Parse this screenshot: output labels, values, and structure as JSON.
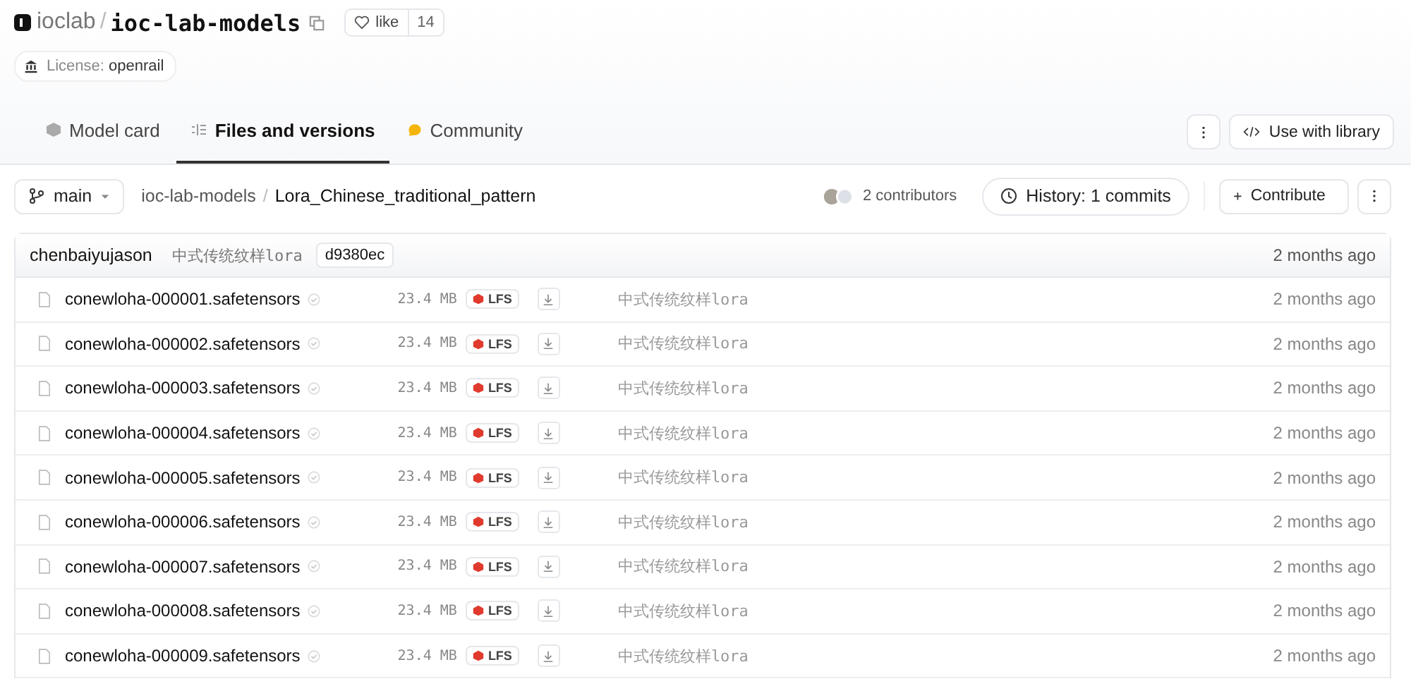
{
  "repo": {
    "owner": "ioclab",
    "separator": "/",
    "name": "ioc-lab-models",
    "like_label": "like",
    "likes": "14"
  },
  "license": {
    "label": "License:",
    "value": "openrail"
  },
  "tabs": [
    {
      "kind": "card",
      "label": "Model card",
      "selected": false
    },
    {
      "kind": "files",
      "label": "Files and versions",
      "selected": true
    },
    {
      "kind": "community",
      "label": "Community",
      "selected": false
    }
  ],
  "actions": {
    "use_with_library": "Use with library"
  },
  "toolbar": {
    "branch": "main",
    "path": [
      {
        "label": "ioc-lab-models"
      },
      {
        "label": "Lora_Chinese_traditional_pattern"
      }
    ],
    "path_separator": "/",
    "contributors": "2 contributors",
    "history": "History: 1 commits",
    "contribute": "Contribute"
  },
  "last_commit": {
    "author": "chenbaiyujason",
    "message": "中式传统纹样lora",
    "hash": "d9380ec",
    "date": "2 months ago"
  },
  "files": [
    {
      "name": "conewloha-000001.safetensors",
      "size": "23.4 MB",
      "lfs": "LFS",
      "message": "中式传统纹样lora",
      "date": "2 months ago"
    },
    {
      "name": "conewloha-000002.safetensors",
      "size": "23.4 MB",
      "lfs": "LFS",
      "message": "中式传统纹样lora",
      "date": "2 months ago"
    },
    {
      "name": "conewloha-000003.safetensors",
      "size": "23.4 MB",
      "lfs": "LFS",
      "message": "中式传统纹样lora",
      "date": "2 months ago"
    },
    {
      "name": "conewloha-000004.safetensors",
      "size": "23.4 MB",
      "lfs": "LFS",
      "message": "中式传统纹样lora",
      "date": "2 months ago"
    },
    {
      "name": "conewloha-000005.safetensors",
      "size": "23.4 MB",
      "lfs": "LFS",
      "message": "中式传统纹样lora",
      "date": "2 months ago"
    },
    {
      "name": "conewloha-000006.safetensors",
      "size": "23.4 MB",
      "lfs": "LFS",
      "message": "中式传统纹样lora",
      "date": "2 months ago"
    },
    {
      "name": "conewloha-000007.safetensors",
      "size": "23.4 MB",
      "lfs": "LFS",
      "message": "中式传统纹样lora",
      "date": "2 months ago"
    },
    {
      "name": "conewloha-000008.safetensors",
      "size": "23.4 MB",
      "lfs": "LFS",
      "message": "中式传统纹样lora",
      "date": "2 months ago"
    },
    {
      "name": "conewloha-000009.safetensors",
      "size": "23.4 MB",
      "lfs": "LFS",
      "message": "中式传统纹样lora",
      "date": "2 months ago"
    }
  ]
}
